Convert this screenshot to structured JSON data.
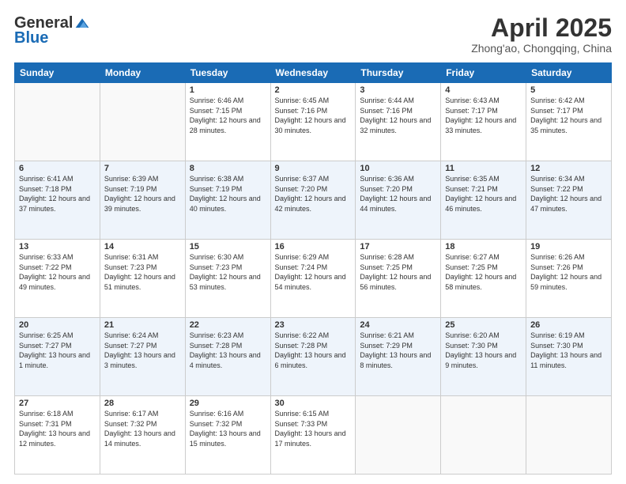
{
  "header": {
    "logo_general": "General",
    "logo_blue": "Blue",
    "month_title": "April 2025",
    "subtitle": "Zhong'ao, Chongqing, China"
  },
  "days_of_week": [
    "Sunday",
    "Monday",
    "Tuesday",
    "Wednesday",
    "Thursday",
    "Friday",
    "Saturday"
  ],
  "weeks": [
    [
      {
        "day": "",
        "info": ""
      },
      {
        "day": "",
        "info": ""
      },
      {
        "day": "1",
        "info": "Sunrise: 6:46 AM\nSunset: 7:15 PM\nDaylight: 12 hours and 28 minutes."
      },
      {
        "day": "2",
        "info": "Sunrise: 6:45 AM\nSunset: 7:16 PM\nDaylight: 12 hours and 30 minutes."
      },
      {
        "day": "3",
        "info": "Sunrise: 6:44 AM\nSunset: 7:16 PM\nDaylight: 12 hours and 32 minutes."
      },
      {
        "day": "4",
        "info": "Sunrise: 6:43 AM\nSunset: 7:17 PM\nDaylight: 12 hours and 33 minutes."
      },
      {
        "day": "5",
        "info": "Sunrise: 6:42 AM\nSunset: 7:17 PM\nDaylight: 12 hours and 35 minutes."
      }
    ],
    [
      {
        "day": "6",
        "info": "Sunrise: 6:41 AM\nSunset: 7:18 PM\nDaylight: 12 hours and 37 minutes."
      },
      {
        "day": "7",
        "info": "Sunrise: 6:39 AM\nSunset: 7:19 PM\nDaylight: 12 hours and 39 minutes."
      },
      {
        "day": "8",
        "info": "Sunrise: 6:38 AM\nSunset: 7:19 PM\nDaylight: 12 hours and 40 minutes."
      },
      {
        "day": "9",
        "info": "Sunrise: 6:37 AM\nSunset: 7:20 PM\nDaylight: 12 hours and 42 minutes."
      },
      {
        "day": "10",
        "info": "Sunrise: 6:36 AM\nSunset: 7:20 PM\nDaylight: 12 hours and 44 minutes."
      },
      {
        "day": "11",
        "info": "Sunrise: 6:35 AM\nSunset: 7:21 PM\nDaylight: 12 hours and 46 minutes."
      },
      {
        "day": "12",
        "info": "Sunrise: 6:34 AM\nSunset: 7:22 PM\nDaylight: 12 hours and 47 minutes."
      }
    ],
    [
      {
        "day": "13",
        "info": "Sunrise: 6:33 AM\nSunset: 7:22 PM\nDaylight: 12 hours and 49 minutes."
      },
      {
        "day": "14",
        "info": "Sunrise: 6:31 AM\nSunset: 7:23 PM\nDaylight: 12 hours and 51 minutes."
      },
      {
        "day": "15",
        "info": "Sunrise: 6:30 AM\nSunset: 7:23 PM\nDaylight: 12 hours and 53 minutes."
      },
      {
        "day": "16",
        "info": "Sunrise: 6:29 AM\nSunset: 7:24 PM\nDaylight: 12 hours and 54 minutes."
      },
      {
        "day": "17",
        "info": "Sunrise: 6:28 AM\nSunset: 7:25 PM\nDaylight: 12 hours and 56 minutes."
      },
      {
        "day": "18",
        "info": "Sunrise: 6:27 AM\nSunset: 7:25 PM\nDaylight: 12 hours and 58 minutes."
      },
      {
        "day": "19",
        "info": "Sunrise: 6:26 AM\nSunset: 7:26 PM\nDaylight: 12 hours and 59 minutes."
      }
    ],
    [
      {
        "day": "20",
        "info": "Sunrise: 6:25 AM\nSunset: 7:27 PM\nDaylight: 13 hours and 1 minute."
      },
      {
        "day": "21",
        "info": "Sunrise: 6:24 AM\nSunset: 7:27 PM\nDaylight: 13 hours and 3 minutes."
      },
      {
        "day": "22",
        "info": "Sunrise: 6:23 AM\nSunset: 7:28 PM\nDaylight: 13 hours and 4 minutes."
      },
      {
        "day": "23",
        "info": "Sunrise: 6:22 AM\nSunset: 7:28 PM\nDaylight: 13 hours and 6 minutes."
      },
      {
        "day": "24",
        "info": "Sunrise: 6:21 AM\nSunset: 7:29 PM\nDaylight: 13 hours and 8 minutes."
      },
      {
        "day": "25",
        "info": "Sunrise: 6:20 AM\nSunset: 7:30 PM\nDaylight: 13 hours and 9 minutes."
      },
      {
        "day": "26",
        "info": "Sunrise: 6:19 AM\nSunset: 7:30 PM\nDaylight: 13 hours and 11 minutes."
      }
    ],
    [
      {
        "day": "27",
        "info": "Sunrise: 6:18 AM\nSunset: 7:31 PM\nDaylight: 13 hours and 12 minutes."
      },
      {
        "day": "28",
        "info": "Sunrise: 6:17 AM\nSunset: 7:32 PM\nDaylight: 13 hours and 14 minutes."
      },
      {
        "day": "29",
        "info": "Sunrise: 6:16 AM\nSunset: 7:32 PM\nDaylight: 13 hours and 15 minutes."
      },
      {
        "day": "30",
        "info": "Sunrise: 6:15 AM\nSunset: 7:33 PM\nDaylight: 13 hours and 17 minutes."
      },
      {
        "day": "",
        "info": ""
      },
      {
        "day": "",
        "info": ""
      },
      {
        "day": "",
        "info": ""
      }
    ]
  ]
}
